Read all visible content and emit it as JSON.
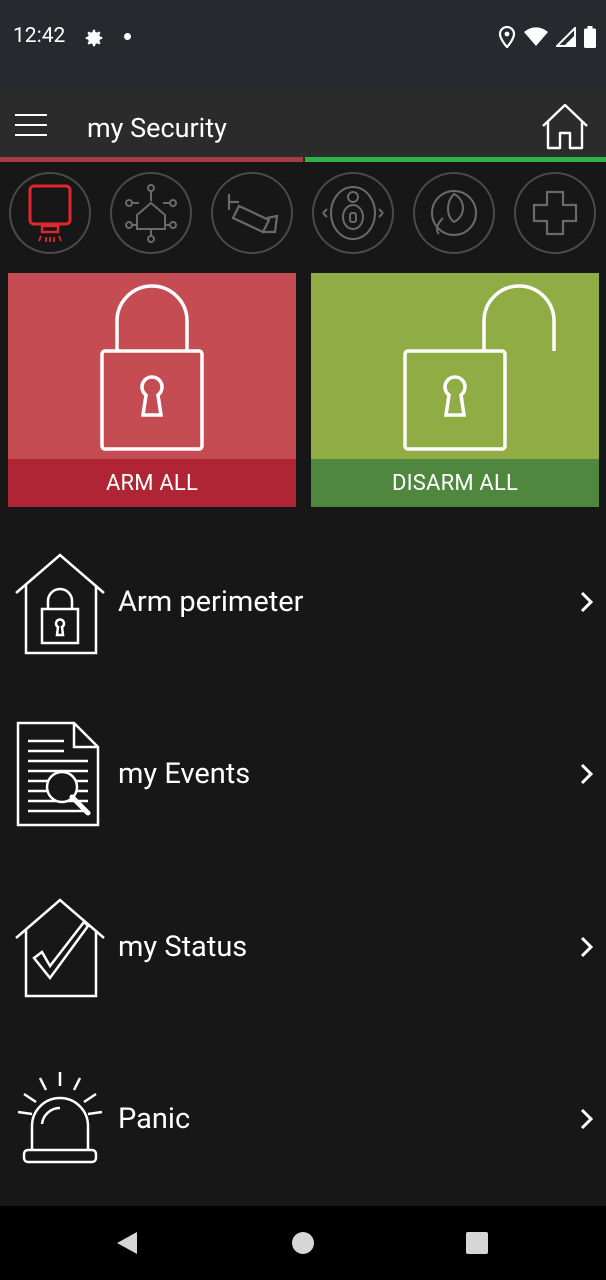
{
  "status_bar": {
    "time": "12:42",
    "icons": [
      "gear-icon",
      "notification-dot",
      "location-icon",
      "wifi-icon",
      "cell-signal-icon",
      "battery-icon"
    ]
  },
  "app_bar": {
    "title": "my Security",
    "menu_icon": "hamburger-menu-icon",
    "home_icon": "home-icon"
  },
  "category_icons": [
    {
      "name": "security-panel",
      "active": true
    },
    {
      "name": "smart-home-network",
      "active": false
    },
    {
      "name": "camera",
      "active": false
    },
    {
      "name": "doorbell",
      "active": false
    },
    {
      "name": "energy",
      "active": false
    },
    {
      "name": "add-plus",
      "active": false
    }
  ],
  "actions": {
    "arm_all": "ARM ALL",
    "disarm_all": "DISARM ALL"
  },
  "menu": [
    {
      "label": "Arm perimeter",
      "icon": "house-lock-icon"
    },
    {
      "label": "my Events",
      "icon": "document-search-icon"
    },
    {
      "label": "my Status",
      "icon": "house-check-icon"
    },
    {
      "label": "Panic",
      "icon": "siren-icon"
    }
  ],
  "colors": {
    "arm_tile": "#c64c53",
    "arm_label": "#b02535",
    "disarm_tile": "#8fac45",
    "disarm_label": "#4f873e",
    "accent_red": "#a33a44",
    "accent_green": "#2eb446"
  }
}
